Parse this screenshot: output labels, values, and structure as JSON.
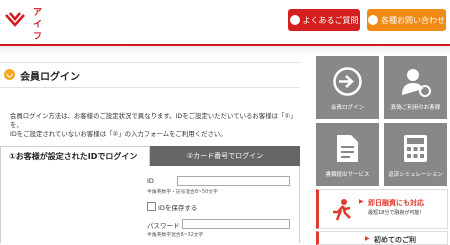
{
  "header": {
    "logo_text_line1": "アイ",
    "logo_text_line2": "フル",
    "faq_button": "よくあるご質問",
    "inquiry_button": "各種お問い合わせ"
  },
  "page_title": "会員ログイン",
  "description": {
    "line1": "会員ログイン方法は、お客様のご設定状況で異なります。IDをご設定いただいているお客様は「①」を、",
    "line2": "IDをご設定されていないお客様は「②」の入力フォームをご利用ください。"
  },
  "tabs": {
    "tab1": "①お客様が設定されたIDでログイン",
    "tab2": "②カード番号でログイン"
  },
  "form": {
    "id_label": "ID",
    "id_hint": "半角英数字・記号混合8~50文字",
    "id_value": "",
    "save_id_label": "IDを保存する",
    "password_label": "パスワード",
    "password_hint": "半角英数字混合8~32文字",
    "password_value": ""
  },
  "sidebar": {
    "tiles": [
      {
        "label": "会員ログイン",
        "icon": "login-arrow-icon"
      },
      {
        "label": "真偽ご利用のお客様",
        "icon": "user-refresh-icon"
      },
      {
        "label": "書類提出サービス",
        "icon": "document-icon"
      },
      {
        "label": "返済シミュレーション",
        "icon": "calculator-icon"
      }
    ],
    "banner": {
      "title": "即日融資にも対応",
      "subtitle": "最短18分で融資が可能！"
    },
    "banner2": {
      "title": "初めてのご利"
    }
  },
  "colors": {
    "brand_red": "#d4181e",
    "faq_button": "#d31f1f",
    "inquiry_button": "#f08a14",
    "tile_gray": "#888888",
    "tab_inactive": "#666666"
  }
}
